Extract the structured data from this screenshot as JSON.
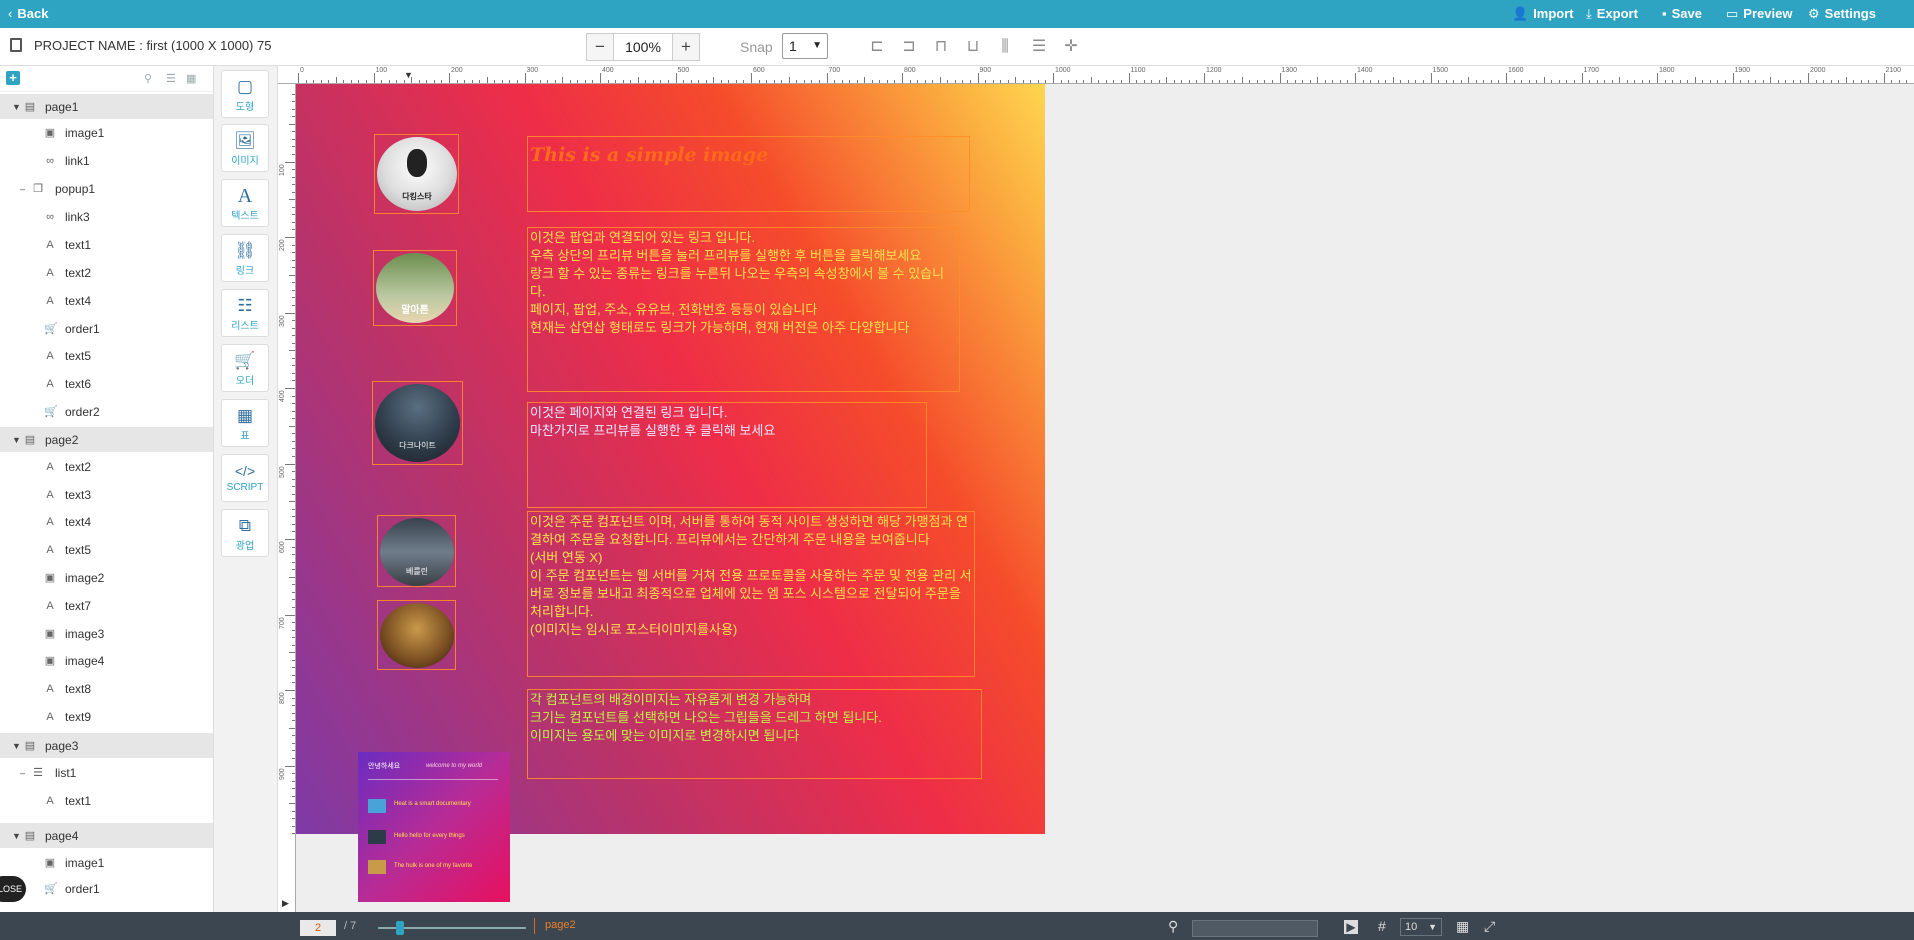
{
  "topbar": {
    "back": "Back",
    "import": "Import",
    "export": "Export",
    "save": "Save",
    "preview": "Preview",
    "settings": "Settings"
  },
  "toolbar": {
    "project_label": "PROJECT NAME  :  first (1000 X 1000)  75",
    "zoom": "100%",
    "snap_label": "Snap",
    "snap_value": "1"
  },
  "tree": {
    "page1": {
      "label": "page1",
      "items": [
        "image1",
        "link1"
      ]
    },
    "popup1": {
      "label": "popup1",
      "items": [
        "link3",
        "text1",
        "text2",
        "text4",
        "order1",
        "text5",
        "text6",
        "order2"
      ]
    },
    "page2": {
      "label": "page2",
      "items": [
        "text2",
        "text3",
        "text4",
        "text5",
        "image2",
        "text7",
        "image3",
        "image4",
        "text8",
        "text9"
      ]
    },
    "page3": {
      "label": "page3"
    },
    "list1": {
      "label": "list1",
      "items": [
        "text1"
      ]
    },
    "page4": {
      "label": "page4",
      "items": [
        "image1",
        "order1"
      ]
    },
    "close": "LOSE"
  },
  "tools": {
    "shape": "도형",
    "image": "이미지",
    "text": "텍스트",
    "link": "링크",
    "list": "리스트",
    "order": "오더",
    "table": "표",
    "script": "SCRIPT",
    "ad": "광업"
  },
  "ruler": {
    "top": [
      "0",
      "100",
      "200",
      "300",
      "400",
      "500",
      "600",
      "700",
      "800",
      "900",
      "1000",
      "1100",
      "1200",
      "1300",
      "1400",
      "1500",
      "1600",
      "1700",
      "1800",
      "1900",
      "2000",
      "2100"
    ],
    "left": [
      "100",
      "200",
      "300",
      "400",
      "500",
      "600",
      "700",
      "800",
      "900"
    ]
  },
  "canvas": {
    "title": "This is a simple image",
    "text1": "이것은 팝업과 연결되어 있는 링크 입니다.\n우측 상단의 프리뷰 버튼을 눌러 프리뷰를 실행한 후 버튼을 클릭해보세요\n랑크 할 수 있는 종류는 링크를 누른뒤 나오는 우측의 속성창에서 볼 수 있습니다.\n페이지, 팝업, 주소, 유유브, 전화번호 등등이 있습니다\n현재는 삽연삽 형태로도 링크가 가능하며, 현재 버전은 아주 다양합니다",
    "text2": "이것은 페이지와 연결된 링크 입니다.\n마찬가지로 프리뷰를 실행한 후 클릭해 보세요",
    "text3": "이것은 주문 컴포넌트 이며, 서버를 통하여 동적 사이트 생성하면  해당 가맹점과 연결하여 주문을 요청합니다. 프리뷰에서는 간단하게 주문 내용을 보여줍니다\n(서버 연동 X)\n이 주문 컴포넌트는 웹 서버를 거쳐 전용 프로토콜을 사용하는 주문 및 전용 관리 서버로  정보를 보내고 최종적으로 업체에 있는 엠 포스 시스템으로 전달되어 주문을 처리합니다.\n(이미지는 임시로 포스터이미지를사용)",
    "text4": "각 컴포넌트의 배경이미지는 자유롭게 변경 가능하며\n크기는 컴포넌트를 선택하면 나오는 그립들을 드레그 하면 됩니다.\n이미지는 용도에 맞는 이미지로 변경하시면 됩니다",
    "poster1": "다킹스타",
    "poster2": "말아톤",
    "poster3": "다크나이트",
    "poster4": "베를린",
    "popup": {
      "greeting": "안녕하세요",
      "welcome": "welcome to my world",
      "line1": "Heat is a smart documentary",
      "line2": "Hello hello for every things",
      "line3": "The hulk is one of my favorite"
    }
  },
  "bottom": {
    "page_current": "2",
    "page_total": "/ 7",
    "page_name": "page2",
    "grid_value": "10"
  },
  "colors": {
    "accent": "#2ea4c2",
    "text_yellow": "#ffe14d",
    "text_green": "#c4f04a",
    "title_orange": "#ff6a1a"
  }
}
